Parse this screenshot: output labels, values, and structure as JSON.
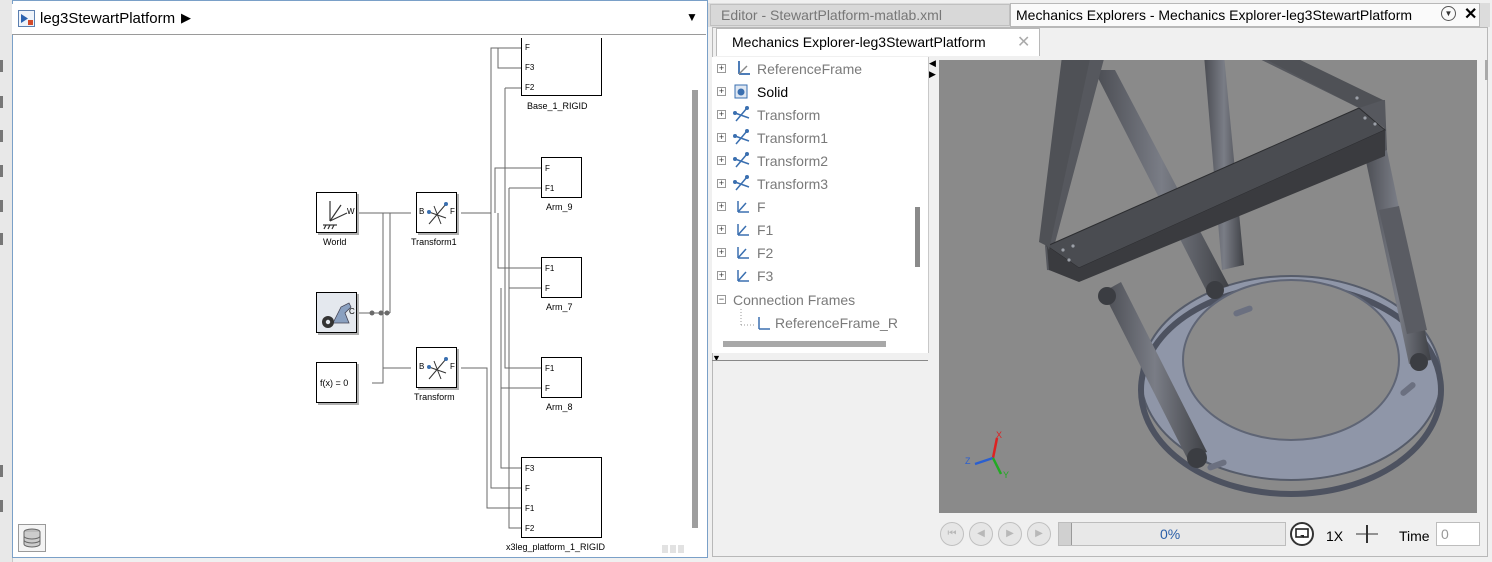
{
  "simulink": {
    "model_name": "leg3StewartPlatform",
    "blocks": {
      "base": {
        "label": "Base_1_RIGID",
        "ports": [
          "F",
          "F3",
          "F2"
        ]
      },
      "arm9": {
        "label": "Arm_9",
        "ports": [
          "F",
          "F1"
        ]
      },
      "arm7": {
        "label": "Arm_7",
        "ports": [
          "F1",
          "F"
        ]
      },
      "arm8": {
        "label": "Arm_8",
        "ports": [
          "F1",
          "F"
        ]
      },
      "platform": {
        "label": "x3leg_platform_1_RIGID",
        "ports": [
          "F3",
          "F",
          "F1",
          "F2"
        ]
      },
      "world": {
        "label": "World",
        "port": "W"
      },
      "config": {
        "port": "C"
      },
      "solver": {
        "text": "f(x) = 0"
      },
      "transform1": {
        "label": "Transform1",
        "port_b": "B",
        "port_f": "F"
      },
      "transform": {
        "label": "Transform",
        "port_b": "B",
        "port_f": "F"
      }
    }
  },
  "tabs": {
    "editor": "Editor - StewartPlatform-matlab.xml",
    "mechanics": "Mechanics Explorers - Mechanics Explorer-leg3StewartPlatform",
    "subtab": "Mechanics Explorer-leg3StewartPlatform"
  },
  "tree": {
    "items": [
      {
        "label": "ReferenceFrame",
        "icon": "reference-frame-icon",
        "dim": true
      },
      {
        "label": "Solid",
        "icon": "solid-icon",
        "dim": false
      },
      {
        "label": "Transform",
        "icon": "transform-icon",
        "dim": true
      },
      {
        "label": "Transform1",
        "icon": "transform-icon",
        "dim": true
      },
      {
        "label": "Transform2",
        "icon": "transform-icon",
        "dim": true
      },
      {
        "label": "Transform3",
        "icon": "transform-icon",
        "dim": true
      },
      {
        "label": "F",
        "icon": "frame-icon",
        "dim": true
      },
      {
        "label": "F1",
        "icon": "frame-icon",
        "dim": true
      },
      {
        "label": "F2",
        "icon": "frame-icon",
        "dim": true
      },
      {
        "label": "F3",
        "icon": "frame-icon",
        "dim": true
      }
    ],
    "connection_frames": "Connection Frames",
    "connection_child": "ReferenceFrame_R"
  },
  "triad": {
    "x": "X",
    "y": "Y",
    "z": "Z"
  },
  "playback": {
    "progress": "0%",
    "progress_fraction": 0,
    "speed": "1X",
    "time_label": "Time",
    "time_value": "0"
  },
  "colors": {
    "viewport_bg": "#8a8a8a",
    "progress_text": "#2a5fa8"
  }
}
